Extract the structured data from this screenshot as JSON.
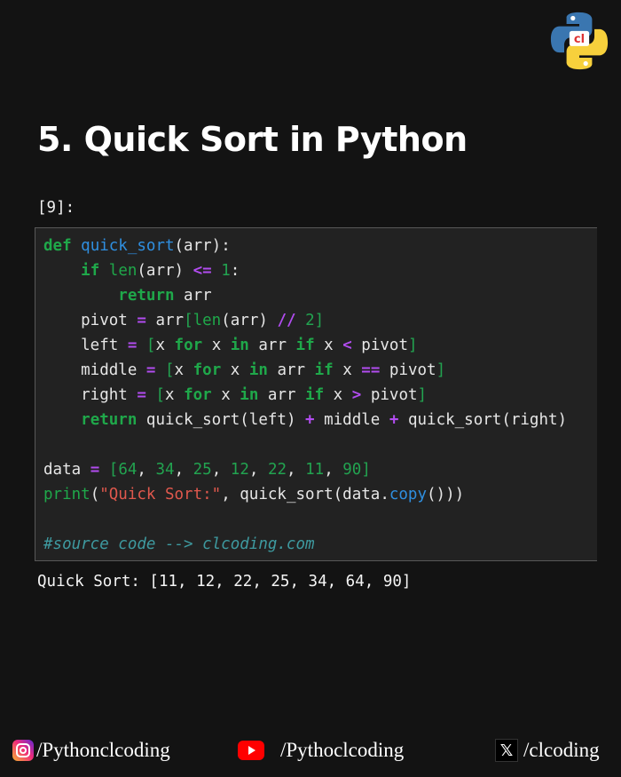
{
  "title": "5. Quick Sort in Python",
  "cell_prompt": "[9]:",
  "code_lines": [
    "def quick_sort(arr):",
    "    if len(arr) <= 1:",
    "        return arr",
    "    pivot = arr[len(arr) // 2]",
    "    left = [x for x in arr if x < pivot]",
    "    middle = [x for x in arr if x == pivot]",
    "    right = [x for x in arr if x > pivot]",
    "    return quick_sort(left) + middle + quick_sort(right)",
    "",
    "data = [64, 34, 25, 12, 22, 11, 90]",
    "print(\"Quick Sort:\", quick_sort(data.copy()))",
    "",
    "#source code --> clcoding.com"
  ],
  "output": "Quick Sort: [11, 12, 22, 25, 34, 64, 90]",
  "footer": {
    "instagram": "/Pythonclcoding",
    "youtube": "/Pythoclcoding",
    "x": "/clcoding"
  },
  "icons": {
    "logo": "python-logo-icon",
    "instagram": "instagram-icon",
    "youtube": "youtube-icon",
    "x": "x-icon"
  },
  "colors": {
    "background": "#131313",
    "code_background": "#222222",
    "keyword": "#1fa84a",
    "function": "#2f8fe0",
    "operator": "#b24cf0",
    "string": "#e0584d",
    "comment": "#3e9aa0"
  }
}
